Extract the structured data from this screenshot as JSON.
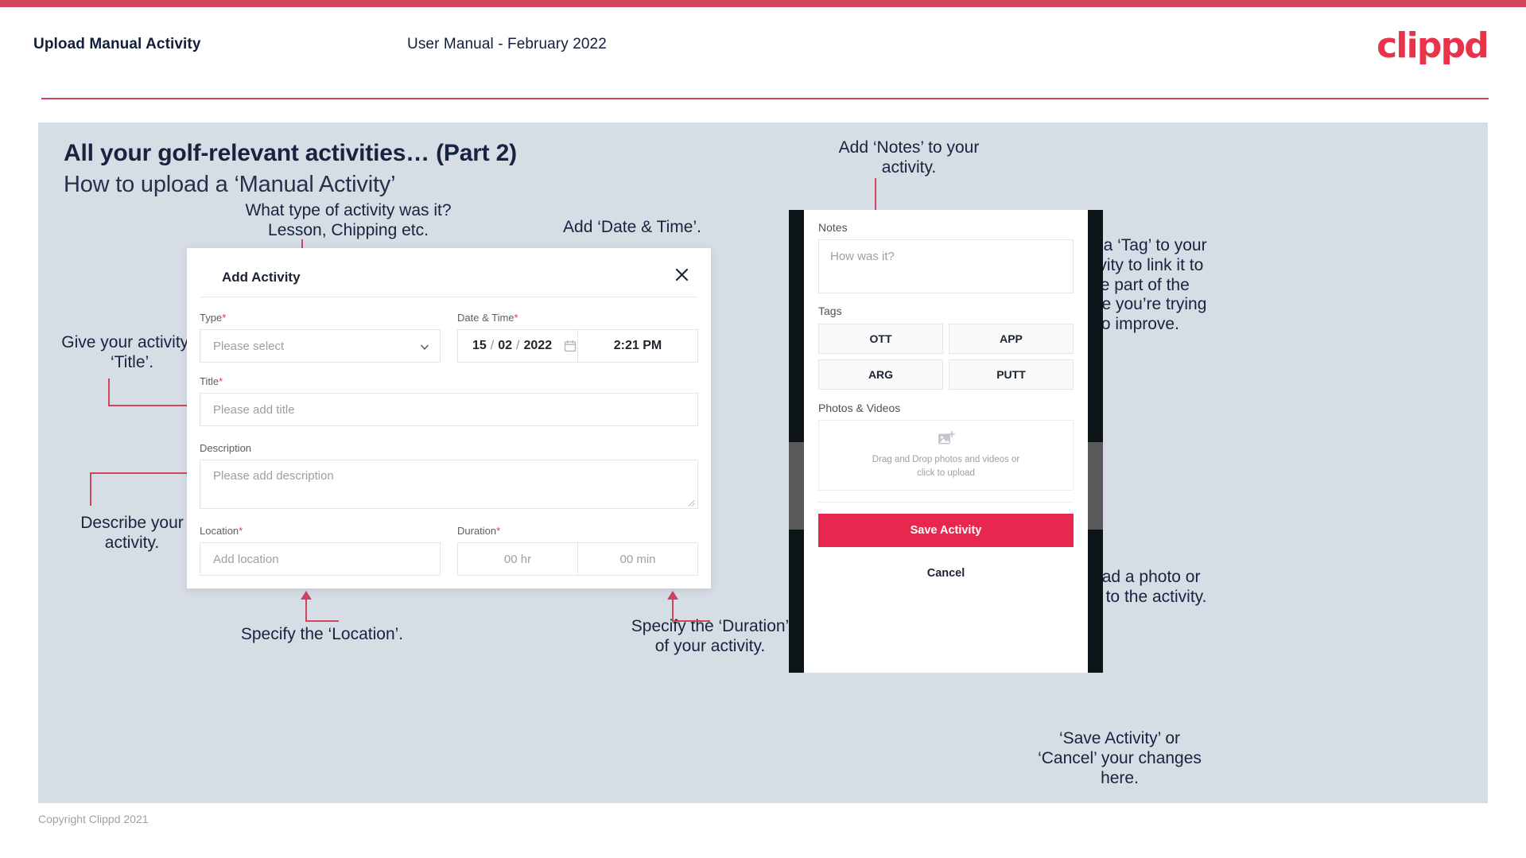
{
  "header": {
    "left_title": "Upload Manual Activity",
    "center_title": "User Manual - February 2022",
    "logo": "clippd"
  },
  "slide": {
    "title": "All your golf-relevant activities… (Part 2)",
    "subtitle": "How to upload a ‘Manual Activity’"
  },
  "callouts": {
    "type": "What type of activity was it?\nLesson, Chipping etc.",
    "datetime": "Add ‘Date & Time’.",
    "title": "Give your activity a\n‘Title’.",
    "description": "Describe your\nactivity.",
    "location": "Specify the ‘Location’.",
    "duration": "Specify the ‘Duration’\nof your activity.",
    "notes": "Add ‘Notes’ to your\nactivity.",
    "tags": "Add a ‘Tag’ to your\nactivity to link it to\nthe part of the\ngame you’re trying\nto improve.",
    "upload": "Upload a photo or\nvideo to the activity.",
    "save_cancel": "‘Save Activity’ or\n‘Cancel’ your changes\nhere."
  },
  "dialog": {
    "title": "Add Activity",
    "close_icon": "close-icon",
    "fields": {
      "type": {
        "label": "Type",
        "required": "*",
        "placeholder": "Please select"
      },
      "datetime": {
        "label": "Date & Time",
        "required": "*",
        "day": "15",
        "month": "02",
        "year": "2022",
        "sep1": "/",
        "sep2": "/",
        "time": "2:21 PM"
      },
      "title": {
        "label": "Title",
        "required": "*",
        "placeholder": "Please add title"
      },
      "description": {
        "label": "Description",
        "required": "",
        "placeholder": "Please add description"
      },
      "location": {
        "label": "Location",
        "required": "*",
        "placeholder": "Add location"
      },
      "duration": {
        "label": "Duration",
        "required": "*",
        "hours": "00 hr",
        "minutes": "00 min"
      }
    }
  },
  "phone": {
    "notes_label": "Notes",
    "notes_placeholder": "How was it?",
    "tags_label": "Tags",
    "tags": [
      "OTT",
      "APP",
      "ARG",
      "PUTT"
    ],
    "media_label": "Photos & Videos",
    "dropzone_text": "Drag and Drop photos and videos or\nclick to upload",
    "save_label": "Save Activity",
    "cancel_label": "Cancel"
  },
  "footer": {
    "copyright": "Copyright Clippd 2021"
  },
  "colors": {
    "accent": "#cf4560",
    "brand_red": "#e8334a",
    "save_button": "#e8274f",
    "slide_bg": "#d7dde5",
    "text_dark": "#16243f"
  }
}
